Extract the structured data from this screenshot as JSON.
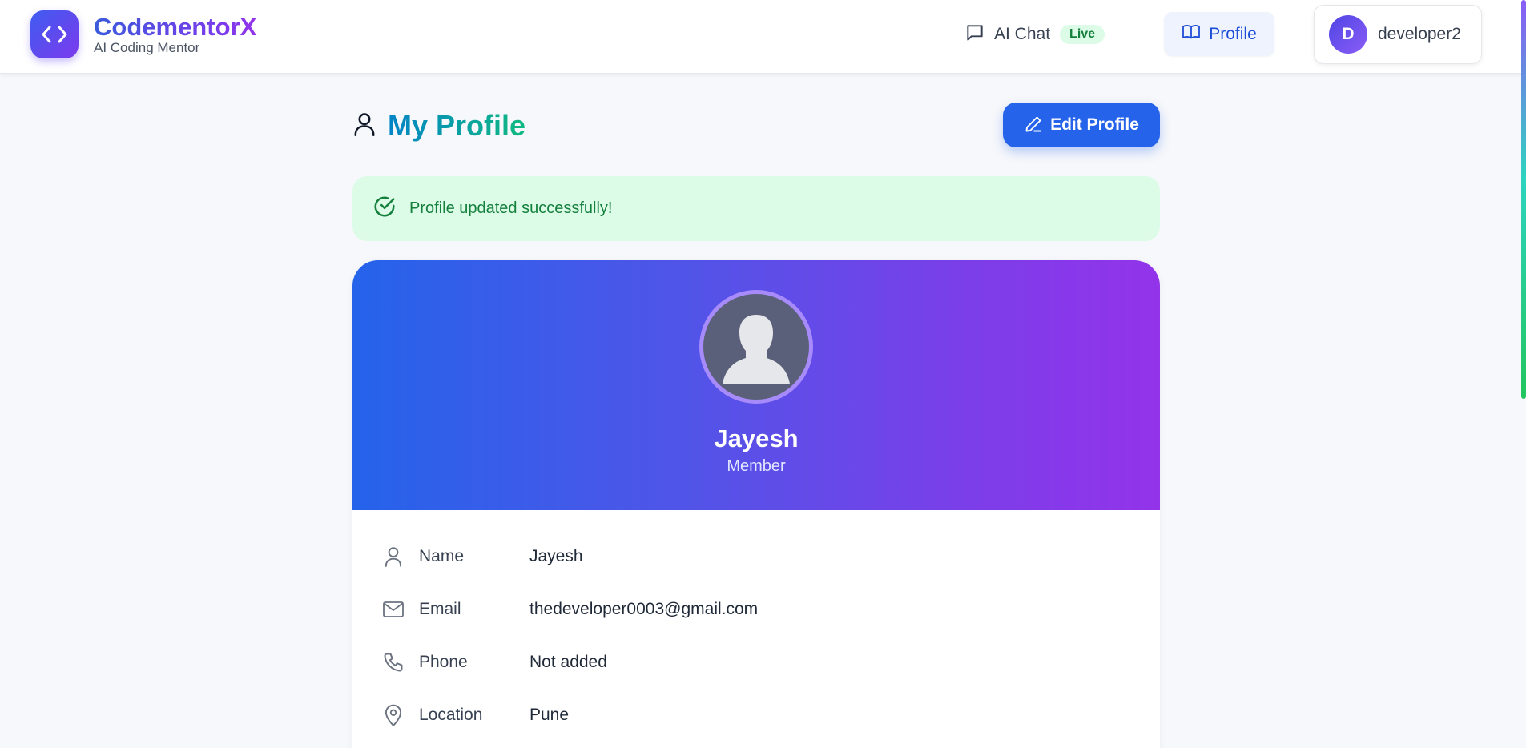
{
  "brand": {
    "title": "CodementorX",
    "subtitle": "AI Coding Mentor",
    "logo_icon": "code-brackets-icon"
  },
  "nav": {
    "chat_label": "AI Chat",
    "chat_badge": "Live",
    "profile_label": "Profile"
  },
  "user": {
    "initial": "D",
    "username": "developer2"
  },
  "page": {
    "title": "My Profile",
    "edit_button": "Edit Profile"
  },
  "alert": {
    "message": "Profile updated successfully!",
    "status": "success"
  },
  "profile": {
    "display_name": "Jayesh",
    "role": "Member",
    "details": [
      {
        "icon": "user-icon",
        "label": "Name",
        "value": "Jayesh"
      },
      {
        "icon": "mail-icon",
        "label": "Email",
        "value": "thedeveloper0003@gmail.com"
      },
      {
        "icon": "phone-icon",
        "label": "Phone",
        "value": "Not added"
      },
      {
        "icon": "map-pin-icon",
        "label": "Location",
        "value": "Pune"
      }
    ]
  },
  "colors": {
    "primary": "#2563eb",
    "accent_purple": "#9333ea",
    "success_bg": "#dcfce7",
    "success_text": "#15803d",
    "title_gradient_start": "#0284c7",
    "title_gradient_end": "#10b981"
  }
}
